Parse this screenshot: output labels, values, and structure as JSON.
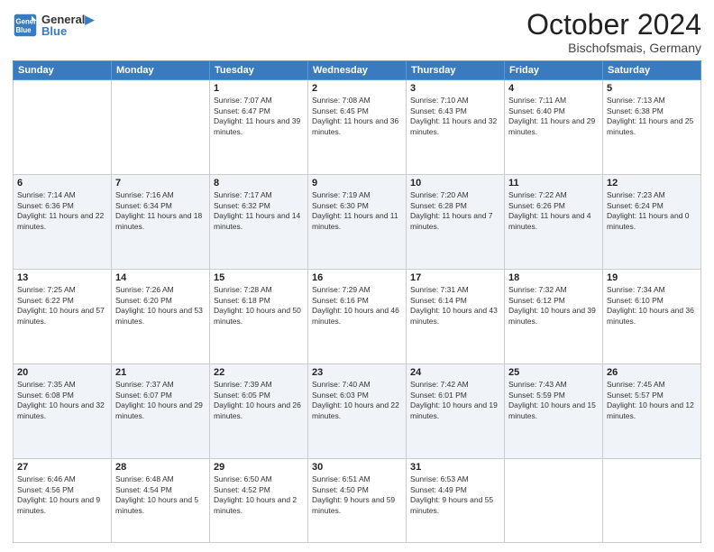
{
  "header": {
    "logo_line1": "General",
    "logo_line2": "Blue",
    "month": "October 2024",
    "location": "Bischofsmais, Germany"
  },
  "days_of_week": [
    "Sunday",
    "Monday",
    "Tuesday",
    "Wednesday",
    "Thursday",
    "Friday",
    "Saturday"
  ],
  "weeks": [
    {
      "cells": [
        {
          "day": "",
          "content": ""
        },
        {
          "day": "",
          "content": ""
        },
        {
          "day": "1",
          "content": "Sunrise: 7:07 AM\nSunset: 6:47 PM\nDaylight: 11 hours and 39 minutes."
        },
        {
          "day": "2",
          "content": "Sunrise: 7:08 AM\nSunset: 6:45 PM\nDaylight: 11 hours and 36 minutes."
        },
        {
          "day": "3",
          "content": "Sunrise: 7:10 AM\nSunset: 6:43 PM\nDaylight: 11 hours and 32 minutes."
        },
        {
          "day": "4",
          "content": "Sunrise: 7:11 AM\nSunset: 6:40 PM\nDaylight: 11 hours and 29 minutes."
        },
        {
          "day": "5",
          "content": "Sunrise: 7:13 AM\nSunset: 6:38 PM\nDaylight: 11 hours and 25 minutes."
        }
      ]
    },
    {
      "cells": [
        {
          "day": "6",
          "content": "Sunrise: 7:14 AM\nSunset: 6:36 PM\nDaylight: 11 hours and 22 minutes."
        },
        {
          "day": "7",
          "content": "Sunrise: 7:16 AM\nSunset: 6:34 PM\nDaylight: 11 hours and 18 minutes."
        },
        {
          "day": "8",
          "content": "Sunrise: 7:17 AM\nSunset: 6:32 PM\nDaylight: 11 hours and 14 minutes."
        },
        {
          "day": "9",
          "content": "Sunrise: 7:19 AM\nSunset: 6:30 PM\nDaylight: 11 hours and 11 minutes."
        },
        {
          "day": "10",
          "content": "Sunrise: 7:20 AM\nSunset: 6:28 PM\nDaylight: 11 hours and 7 minutes."
        },
        {
          "day": "11",
          "content": "Sunrise: 7:22 AM\nSunset: 6:26 PM\nDaylight: 11 hours and 4 minutes."
        },
        {
          "day": "12",
          "content": "Sunrise: 7:23 AM\nSunset: 6:24 PM\nDaylight: 11 hours and 0 minutes."
        }
      ]
    },
    {
      "cells": [
        {
          "day": "13",
          "content": "Sunrise: 7:25 AM\nSunset: 6:22 PM\nDaylight: 10 hours and 57 minutes."
        },
        {
          "day": "14",
          "content": "Sunrise: 7:26 AM\nSunset: 6:20 PM\nDaylight: 10 hours and 53 minutes."
        },
        {
          "day": "15",
          "content": "Sunrise: 7:28 AM\nSunset: 6:18 PM\nDaylight: 10 hours and 50 minutes."
        },
        {
          "day": "16",
          "content": "Sunrise: 7:29 AM\nSunset: 6:16 PM\nDaylight: 10 hours and 46 minutes."
        },
        {
          "day": "17",
          "content": "Sunrise: 7:31 AM\nSunset: 6:14 PM\nDaylight: 10 hours and 43 minutes."
        },
        {
          "day": "18",
          "content": "Sunrise: 7:32 AM\nSunset: 6:12 PM\nDaylight: 10 hours and 39 minutes."
        },
        {
          "day": "19",
          "content": "Sunrise: 7:34 AM\nSunset: 6:10 PM\nDaylight: 10 hours and 36 minutes."
        }
      ]
    },
    {
      "cells": [
        {
          "day": "20",
          "content": "Sunrise: 7:35 AM\nSunset: 6:08 PM\nDaylight: 10 hours and 32 minutes."
        },
        {
          "day": "21",
          "content": "Sunrise: 7:37 AM\nSunset: 6:07 PM\nDaylight: 10 hours and 29 minutes."
        },
        {
          "day": "22",
          "content": "Sunrise: 7:39 AM\nSunset: 6:05 PM\nDaylight: 10 hours and 26 minutes."
        },
        {
          "day": "23",
          "content": "Sunrise: 7:40 AM\nSunset: 6:03 PM\nDaylight: 10 hours and 22 minutes."
        },
        {
          "day": "24",
          "content": "Sunrise: 7:42 AM\nSunset: 6:01 PM\nDaylight: 10 hours and 19 minutes."
        },
        {
          "day": "25",
          "content": "Sunrise: 7:43 AM\nSunset: 5:59 PM\nDaylight: 10 hours and 15 minutes."
        },
        {
          "day": "26",
          "content": "Sunrise: 7:45 AM\nSunset: 5:57 PM\nDaylight: 10 hours and 12 minutes."
        }
      ]
    },
    {
      "cells": [
        {
          "day": "27",
          "content": "Sunrise: 6:46 AM\nSunset: 4:56 PM\nDaylight: 10 hours and 9 minutes."
        },
        {
          "day": "28",
          "content": "Sunrise: 6:48 AM\nSunset: 4:54 PM\nDaylight: 10 hours and 5 minutes."
        },
        {
          "day": "29",
          "content": "Sunrise: 6:50 AM\nSunset: 4:52 PM\nDaylight: 10 hours and 2 minutes."
        },
        {
          "day": "30",
          "content": "Sunrise: 6:51 AM\nSunset: 4:50 PM\nDaylight: 9 hours and 59 minutes."
        },
        {
          "day": "31",
          "content": "Sunrise: 6:53 AM\nSunset: 4:49 PM\nDaylight: 9 hours and 55 minutes."
        },
        {
          "day": "",
          "content": ""
        },
        {
          "day": "",
          "content": ""
        }
      ]
    }
  ]
}
